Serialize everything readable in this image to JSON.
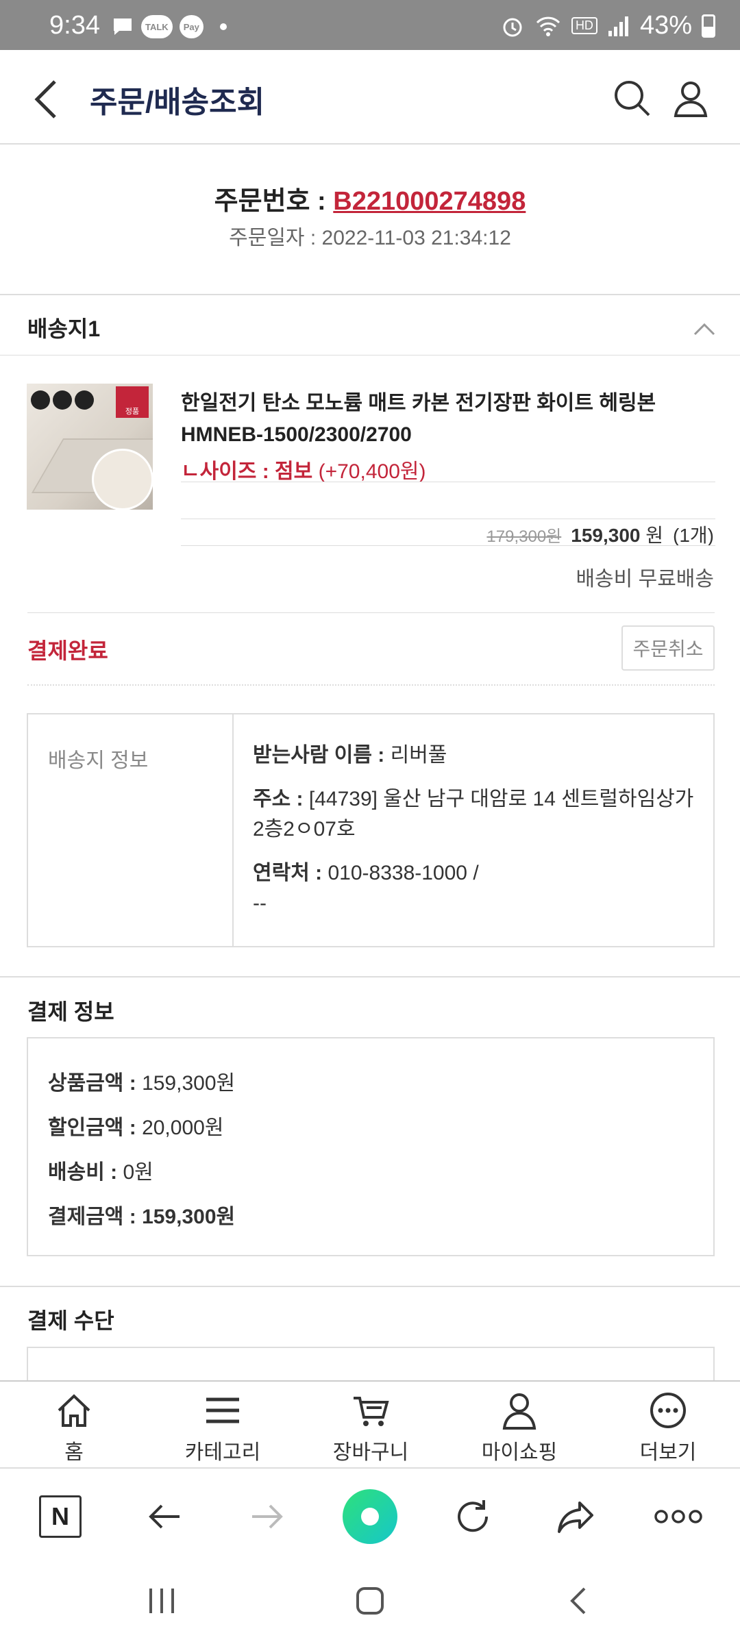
{
  "status_bar": {
    "time": "9:34",
    "chips": [
      "TALK",
      "Pay"
    ],
    "battery": "43%",
    "hd_label": "HD"
  },
  "header": {
    "title": "주문/배송조회"
  },
  "order": {
    "number_label": "주문번호 : ",
    "number": "B221000274898",
    "date_label": "주문일자 : ",
    "date": "2022-11-03 21:34:12"
  },
  "shipping_section": {
    "title": "배송지1"
  },
  "product": {
    "name": "한일전기 탄소 모노륨 매트 카본 전기장판 화이트 헤링본 HMNEB-1500/2300/2700",
    "option_label": "ㄴ사이즈 : 점보",
    "option_value": "(+70,400원)",
    "original_price": "179,300원",
    "price": "159,300",
    "price_unit": "원",
    "quantity": "(1개)",
    "shipping_fee": "배송비 무료배송",
    "image_badges": [
      "싱글",
      "더블",
      "점보"
    ],
    "image_logo": "정품"
  },
  "order_status": {
    "label": "결제완료",
    "cancel_button": "주문취소"
  },
  "delivery_info": {
    "title": "배송지 정보",
    "recipient_label": "받는사람 이름 : ",
    "recipient": "리버풀",
    "address_label": "주소 : ",
    "address": "[44739] 울산 남구 대암로 14 센트럴하임상가2층2ㅇ07호",
    "phone_label": "연락처 : ",
    "phone": "010-8338-1000 /",
    "phone2": "--"
  },
  "payment_info": {
    "title": "결제 정보",
    "rows": [
      {
        "label": "상품금액 : ",
        "value": "159,300원"
      },
      {
        "label": "할인금액 : ",
        "value": "20,000원"
      },
      {
        "label": "배송비 : ",
        "value": "0원"
      },
      {
        "label": "결제금액 : ",
        "value": "159,300원"
      }
    ]
  },
  "payment_method": {
    "title": "결제 수단"
  },
  "tabbar": {
    "items": [
      {
        "label": "홈",
        "icon": "home-icon"
      },
      {
        "label": "카테고리",
        "icon": "menu-icon"
      },
      {
        "label": "장바구니",
        "icon": "cart-icon"
      },
      {
        "label": "마이쇼핑",
        "icon": "user-icon"
      },
      {
        "label": "더보기",
        "icon": "more-icon"
      }
    ]
  },
  "browser_bar": {
    "n_label": "N"
  },
  "colors": {
    "accent": "#c3253a",
    "title_navy": "#1f2a50",
    "status_bar": "#8a8a8a"
  }
}
